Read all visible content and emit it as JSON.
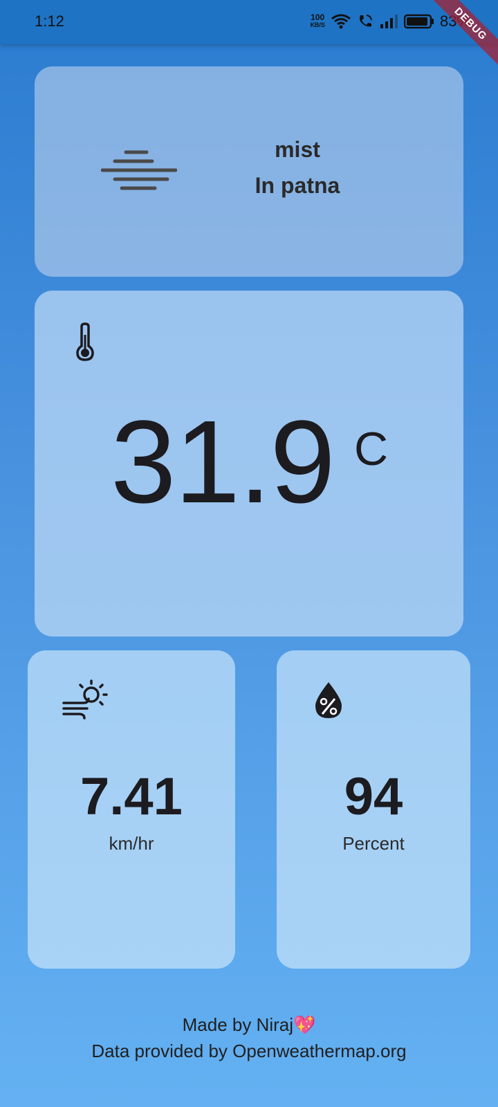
{
  "status_bar": {
    "time": "1:12",
    "net_speed_value": "100",
    "net_speed_unit": "KB/S",
    "battery_percent": "83%"
  },
  "debug_banner": "DEBUG",
  "weather": {
    "condition": "mist",
    "city": "In patna",
    "temperature": "31.9",
    "temperature_unit": "C",
    "wind_speed": "7.41",
    "wind_unit": "km/hr",
    "humidity": "94",
    "humidity_unit": "Percent"
  },
  "footer": {
    "made_by": "Made by Niraj",
    "heart_emoji": "💖",
    "credit": "Data provided by Openweathermap.org"
  },
  "colors": {
    "background_top": "#2a7bd0",
    "background_bottom": "#64b1f2",
    "status_bar": "#1f73c4",
    "card": "#bedcf5",
    "debug_ribbon": "#a42134"
  },
  "icons": [
    "mist-icon",
    "thermometer-icon",
    "wind-icon",
    "humidity-icon",
    "wifi-icon",
    "call-icon",
    "signal-icon",
    "battery-icon"
  ]
}
